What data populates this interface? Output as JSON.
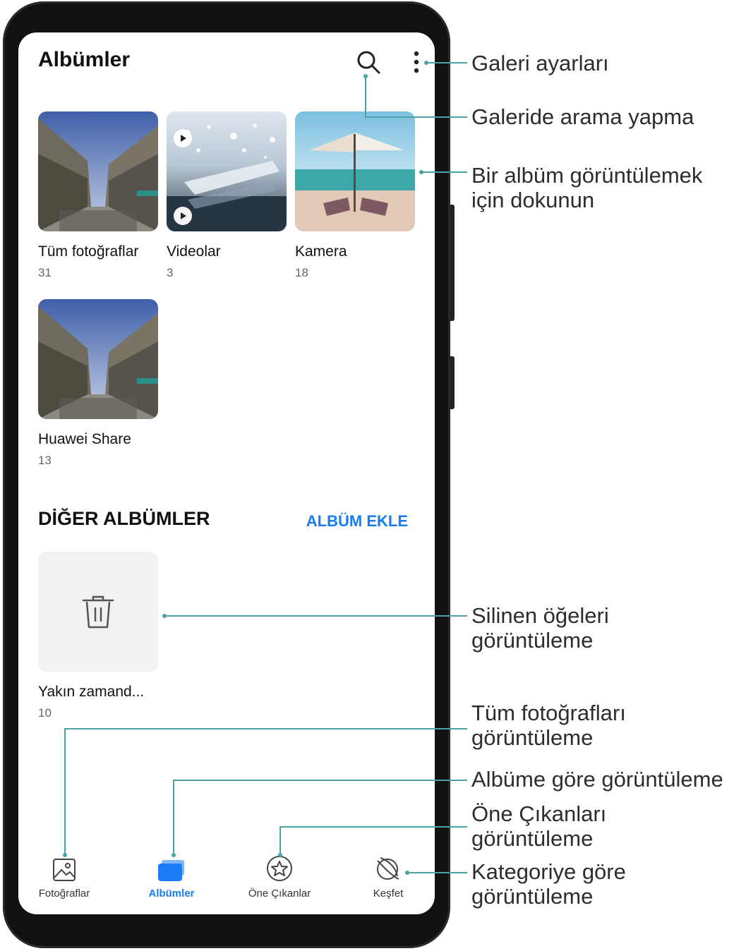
{
  "header": {
    "title": "Albümler",
    "search_icon": "search-icon",
    "menu_icon": "more-vertical-icon"
  },
  "albums": [
    {
      "name": "Tüm fotoğraflar",
      "count": "31"
    },
    {
      "name": "Videolar",
      "count": "3"
    },
    {
      "name": "Kamera",
      "count": "18"
    },
    {
      "name": "Huawei Share",
      "count": "13"
    }
  ],
  "other_albums": {
    "title": "DİĞER ALBÜMLER",
    "add_label": "ALBÜM EKLE",
    "items": [
      {
        "name": "Yakın zamand...",
        "count": "10",
        "icon": "trash-icon"
      }
    ]
  },
  "nav": [
    {
      "label": "Fotoğraflar",
      "icon": "photo-icon",
      "active": false
    },
    {
      "label": "Albümler",
      "icon": "albums-icon",
      "active": true
    },
    {
      "label": "Öne Çıkanlar",
      "icon": "star-icon",
      "active": false
    },
    {
      "label": "Keşfet",
      "icon": "discover-icon",
      "active": false
    }
  ],
  "callouts": {
    "settings": "Galeri ayarları",
    "search": "Galeride arama yapma",
    "view_album_1": "Bir albüm görüntülemek",
    "view_album_2": "için dokunun",
    "deleted_1": "Silinen öğeleri",
    "deleted_2": "görüntüleme",
    "all_photos_1": "Tüm fotoğrafları",
    "all_photos_2": "görüntüleme",
    "by_album": "Albüme göre görüntüleme",
    "highlights_1": "Öne Çıkanları",
    "highlights_2": "görüntüleme",
    "category_1": "Kategoriye göre",
    "category_2": "görüntüleme"
  },
  "colors": {
    "accent": "#1a7cf5",
    "callout_line": "#4aa3a3",
    "frame": "#111111"
  }
}
